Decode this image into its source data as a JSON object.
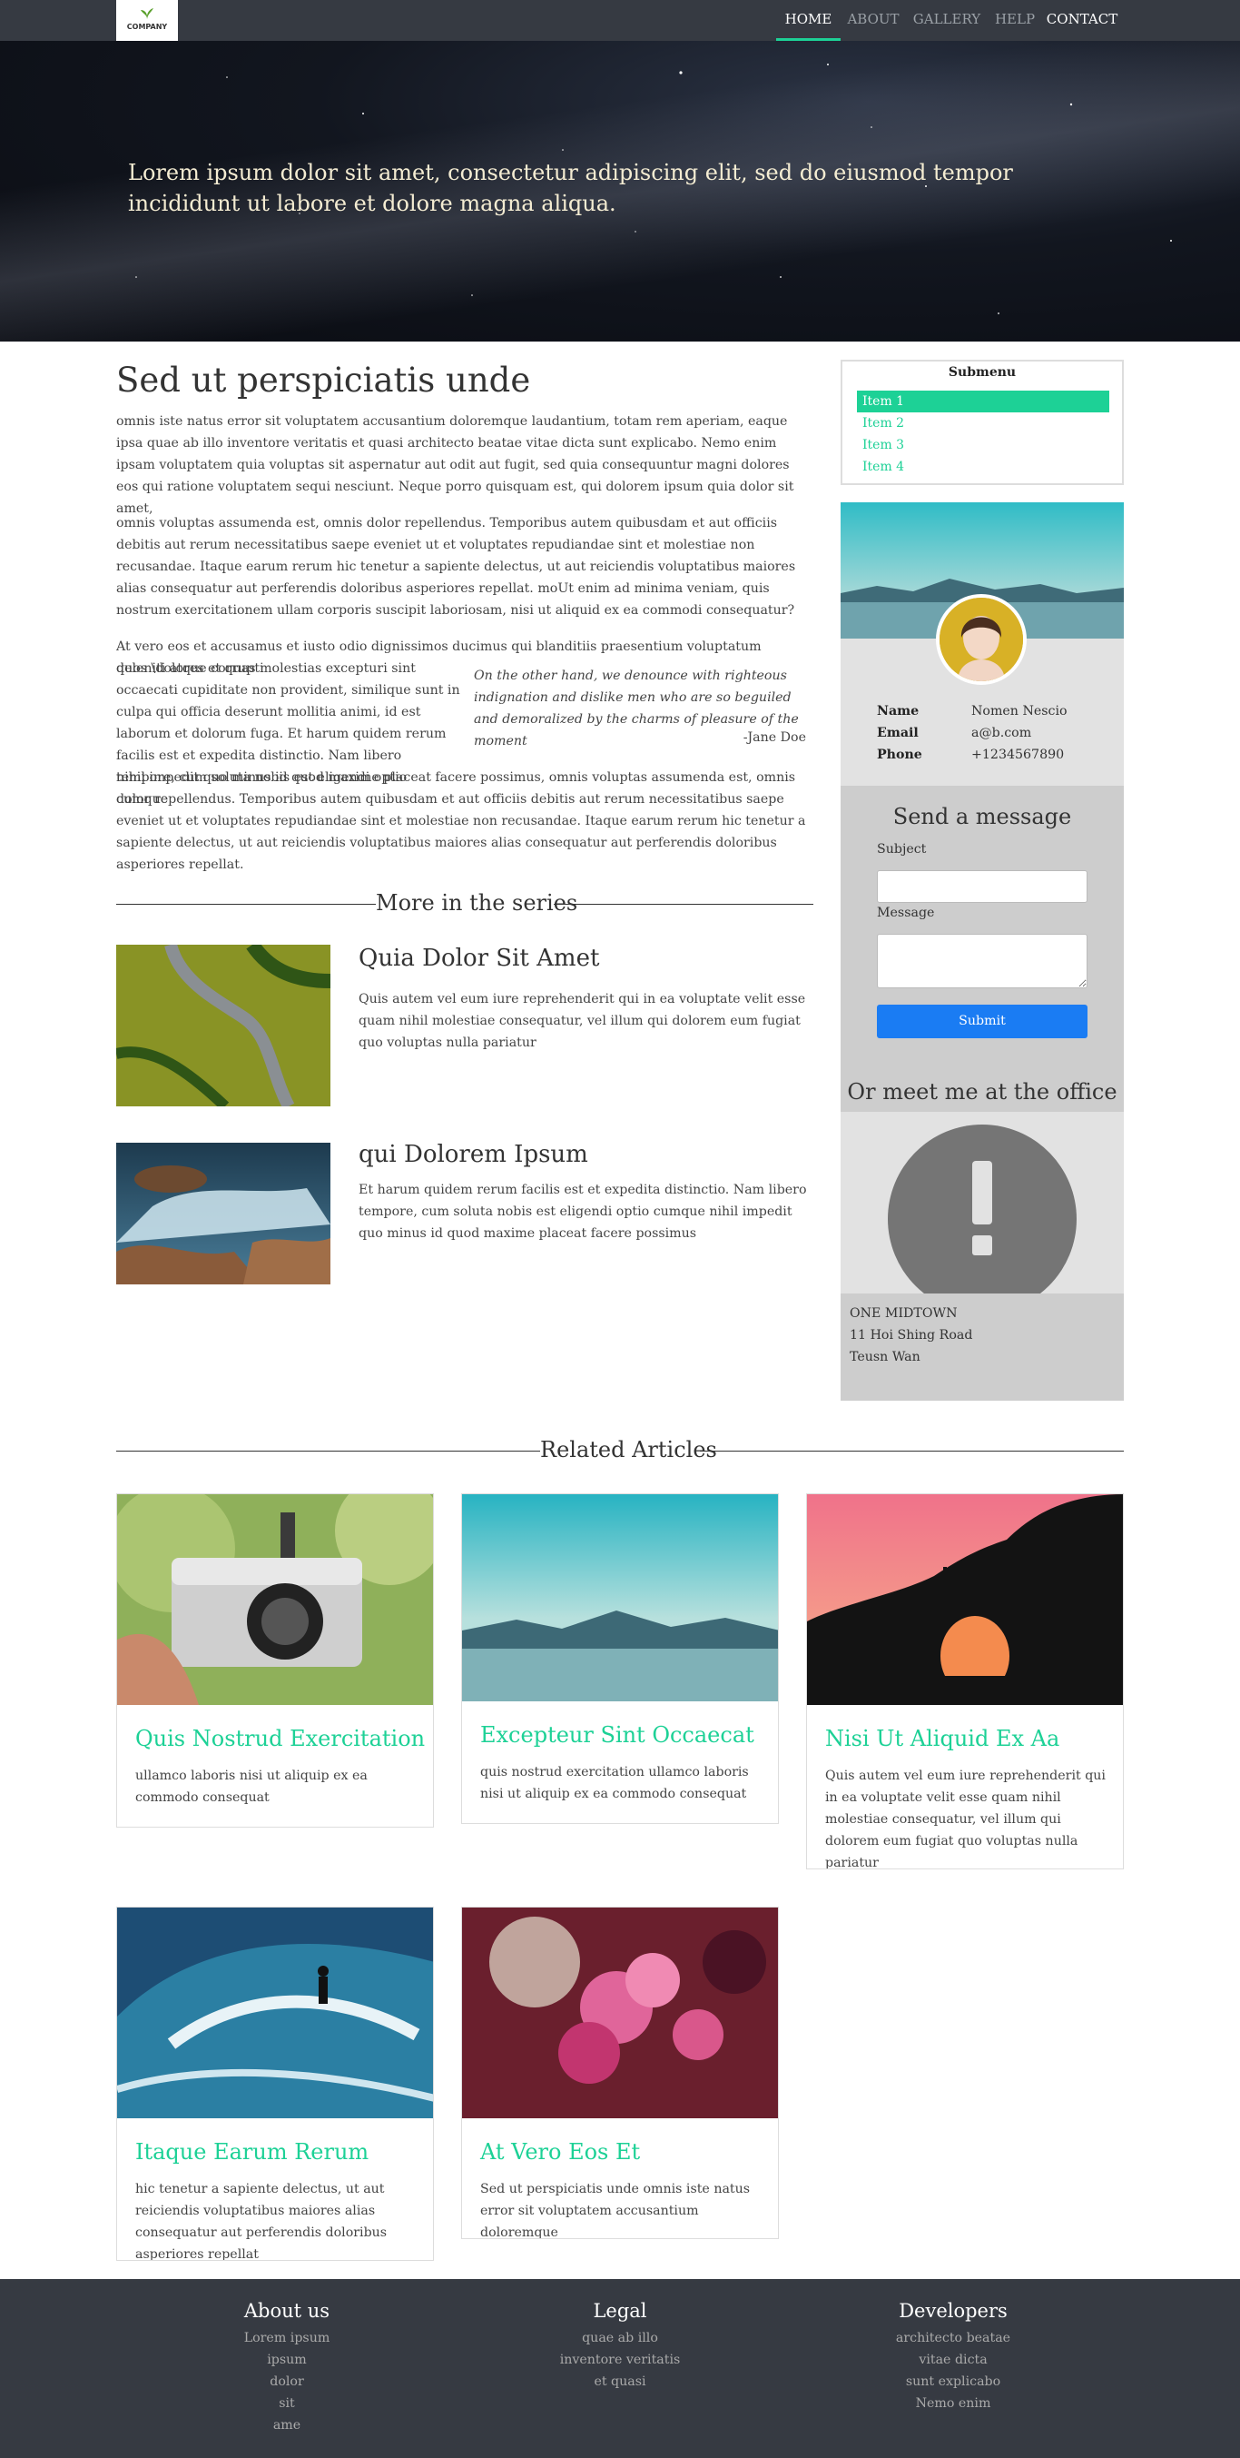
{
  "nav": {
    "logo_text": "COMPANY",
    "items": [
      {
        "label": "HOME"
      },
      {
        "label": "ABOUT"
      },
      {
        "label": "GALLERY"
      },
      {
        "label": "HELP"
      },
      {
        "label": "CONTACT"
      }
    ],
    "accent_color": "#1dd196"
  },
  "hero": {
    "text": "Lorem ipsum dolor sit amet, consectetur adipiscing elit, sed do eiusmod tempor incididunt ut labore et dolore magna aliqua."
  },
  "article": {
    "title": "Sed ut perspiciatis unde",
    "p1": "omnis iste natus error sit voluptatem accusantium doloremque laudantium, totam rem aperiam, eaque ipsa quae ab illo inventore veritatis et quasi architecto beatae vitae dicta sunt explicabo. Nemo enim ipsam voluptatem quia voluptas sit aspernatur aut odit aut fugit, sed quia consequuntur magni dolores eos qui ratione voluptatem sequi nesciunt. Neque porro quisquam est, qui dolorem ipsum quia dolor sit amet,",
    "p2": "omnis voluptas assumenda est, omnis dolor repellendus. Temporibus autem quibusdam et aut officiis debitis aut rerum necessitatibus saepe eveniet ut et voluptates repudiandae sint et molestiae non recusandae. Itaque earum rerum hic tenetur a sapiente delectus, ut aut reiciendis voluptatibus maiores alias consequatur aut perferendis doloribus asperiores repellat. moUt enim ad minima veniam, quis nostrum exercitationem ullam corporis suscipit laboriosam, nisi ut aliquid ex ea commodi consequatur?",
    "p3_line1": "At vero eos et accusamus et iusto odio dignissimos ducimus qui blanditiis praesentium voluptatum deleniti atque corrupti",
    "p3_left": "quos \\dolores et quas molestias excepturi sint occaecati cupiditate non provident, similique sunt in culpa qui officia deserunt mollitia animi, id est laborum et dolorum fuga. Et harum quidem rerum facilis est et expedita distinctio. Nam libero tempore, cum soluta nobis est eligendi optio cumque",
    "p3_rest": "nihil impedit quo minus id quod maxime placeat facere possimus, omnis voluptas assumenda est, omnis dolor repellendus. Temporibus autem quibusdam et aut officiis debitis aut rerum necessitatibus saepe eveniet ut et voluptates repudiandae sint et molestiae non recusandae. Itaque earum rerum hic tenetur a sapiente delectus, ut aut reiciendis voluptatibus maiores alias consequatur aut perferendis doloribus asperiores repellat.",
    "quote": "On the other hand, we denounce with righteous indignation and dislike men who are so beguiled and demoralized by the charms of pleasure of the moment",
    "quote_author": "-Jane Doe"
  },
  "series": {
    "heading": "More in the series",
    "items": [
      {
        "title": "Quia Dolor Sit Amet",
        "text": "Quis autem vel eum iure reprehenderit qui in ea voluptate velit esse quam nihil molestiae consequatur, vel illum qui dolorem eum fugiat quo voluptas nulla pariatur"
      },
      {
        "title": "qui Dolorem Ipsum",
        "text": "Et harum quidem rerum facilis est et expedita distinctio. Nam libero tempore, cum soluta nobis est eligendi optio cumque nihil impedit quo minus id quod maxime placeat facere possimus"
      }
    ]
  },
  "sidebar": {
    "submenu_title": "Submenu",
    "submenu_items": [
      {
        "label": "Item 1"
      },
      {
        "label": "Item 2"
      },
      {
        "label": "Item 3"
      },
      {
        "label": "Item 4"
      }
    ],
    "profile": {
      "name_label": "Name",
      "name": "Nomen Nescio",
      "email_label": "Email",
      "email": "a@b.com",
      "phone_label": "Phone",
      "phone": "+1234567890"
    },
    "message": {
      "title": "Send a message",
      "subject_label": "Subject",
      "message_label": "Message",
      "submit_label": "Submit"
    },
    "office": {
      "title": "Or meet me at the office",
      "address_lines": [
        "ONE MIDTOWN",
        "11 Hoi Shing Road",
        "Teusn Wan"
      ]
    }
  },
  "related": {
    "heading": "Related Articles",
    "cards": [
      {
        "title": "Quis Nostrud Exercitation",
        "text": "ullamco laboris nisi ut aliquip ex ea commodo consequat"
      },
      {
        "title": "Excepteur Sint Occaecat",
        "text": "quis nostrud exercitation ullamco laboris nisi ut aliquip ex ea commodo consequat"
      },
      {
        "title": "Nisi Ut Aliquid Ex Aa",
        "text": "Quis autem vel eum iure reprehenderit qui in ea voluptate velit esse quam nihil molestiae consequatur, vel illum qui dolorem eum fugiat quo voluptas nulla pariatur"
      },
      {
        "title": "Itaque Earum Rerum",
        "text": "hic tenetur a sapiente delectus, ut aut reiciendis voluptatibus maiores alias consequatur aut perferendis doloribus asperiores repellat"
      },
      {
        "title": "At Vero Eos Et",
        "text": "Sed ut perspiciatis unde omnis iste natus error sit voluptatem accusantium doloremque"
      }
    ]
  },
  "footer": {
    "columns": [
      {
        "title": "About us",
        "items": [
          "Lorem ipsum",
          "ipsum",
          "dolor",
          "sit",
          "ame"
        ]
      },
      {
        "title": "Legal",
        "items": [
          "quae ab illo",
          "inventore veritatis",
          "et quasi"
        ]
      },
      {
        "title": "Developers",
        "items": [
          "architecto beatae",
          "vitae dicta",
          "sunt explicabo",
          "Nemo enim"
        ]
      }
    ]
  }
}
